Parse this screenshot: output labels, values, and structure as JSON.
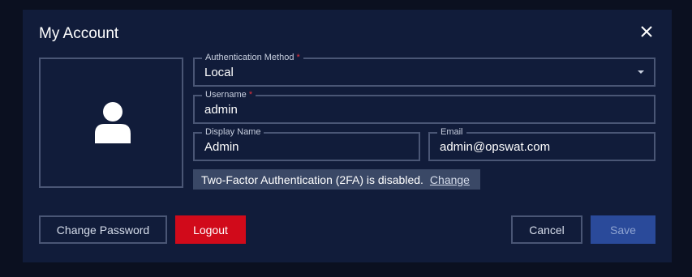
{
  "dialog": {
    "title": "My Account",
    "close_icon": "close-icon",
    "avatar_icon": "user-icon"
  },
  "form": {
    "auth_method": {
      "label": "Authentication Method",
      "required_mark": "*",
      "value": "Local"
    },
    "username": {
      "label": "Username",
      "required_mark": "*",
      "value": "admin"
    },
    "display_name": {
      "label": "Display Name",
      "value": "Admin"
    },
    "email": {
      "label": "Email",
      "value": "admin@opswat.com"
    }
  },
  "two_factor": {
    "message": "Two-Factor Authentication (2FA) is disabled.",
    "link": "Change"
  },
  "buttons": {
    "change_password": "Change Password",
    "logout": "Logout",
    "cancel": "Cancel",
    "save": "Save"
  },
  "colors": {
    "background": "#0b1020",
    "dialog": "#111c3a",
    "logout": "#d10a1a",
    "save": "#2a4a9a",
    "border": "#4a5675"
  }
}
